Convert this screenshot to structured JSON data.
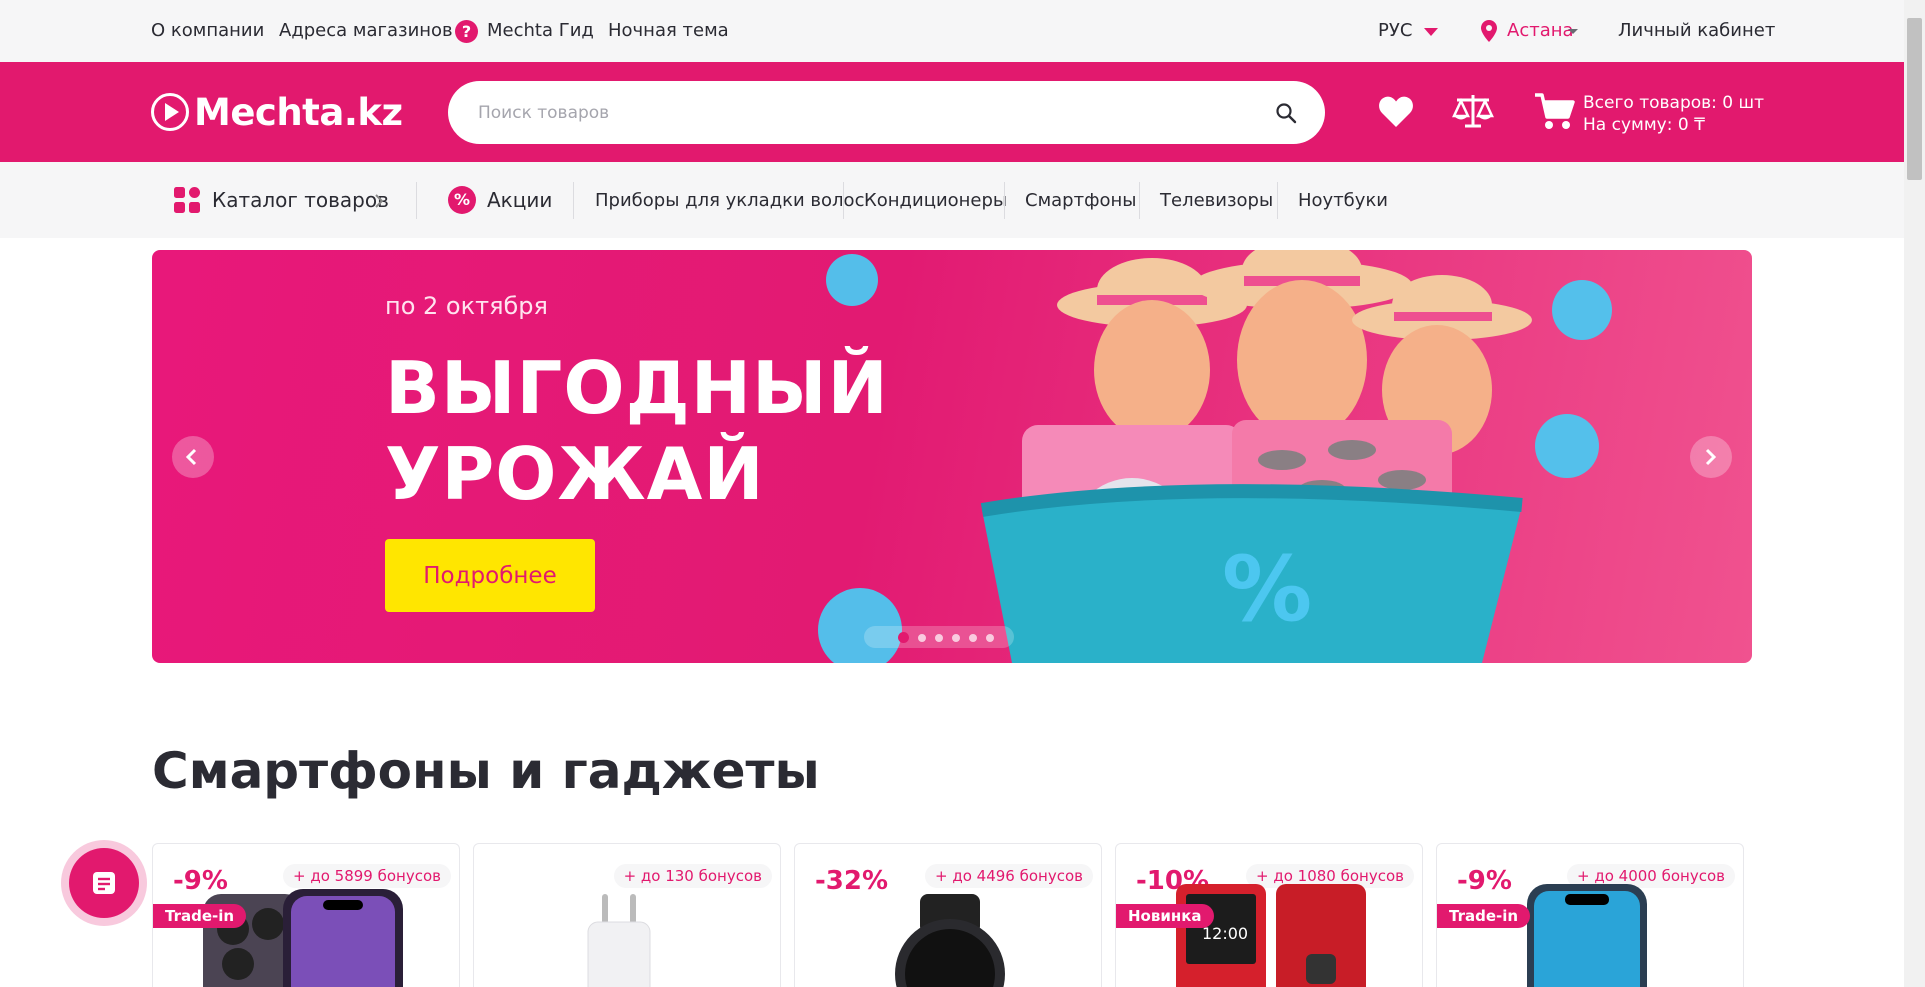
{
  "topbar": {
    "about": "О компании",
    "stores": "Адреса магазинов",
    "guide": "Mechta Гид",
    "dark_theme": "Ночная тема",
    "language": "РУС",
    "city": "Астана",
    "account": "Личный кабинет"
  },
  "header": {
    "logo": "Mechta.kz",
    "search_placeholder": "Поиск товаров",
    "cart_total_items": "Всего товаров: 0 шт",
    "cart_total_sum": "На сумму: 0 ₸"
  },
  "nav": {
    "catalog": "Каталог товаров",
    "promo": "Акции",
    "items": [
      "Приборы для укладки волос",
      "Кондиционеры",
      "Смартфоны",
      "Телевизоры",
      "Ноутбуки"
    ]
  },
  "banner": {
    "date": "по 2 октября",
    "title_line1": "ВЫГОДНЫЙ",
    "title_line2": "УРОЖАЙ",
    "button": "Подробнее",
    "slide_count": 6,
    "active_slide": 1
  },
  "section": {
    "title": "Смартфоны и гаджеты",
    "cards": [
      {
        "discount": "-9%",
        "bonus": "+ до 5899 бонусов",
        "tag": "Trade-in"
      },
      {
        "discount": "",
        "bonus": "+ до 130 бонусов",
        "tag": ""
      },
      {
        "discount": "-32%",
        "bonus": "+ до 4496 бонусов",
        "tag": ""
      },
      {
        "discount": "-10%",
        "bonus": "+ до 1080 бонусов",
        "tag": "Новинка"
      },
      {
        "discount": "-9%",
        "bonus": "+ до 4000 бонусов",
        "tag": "Trade-in"
      }
    ]
  },
  "colors": {
    "brand": "#e2196e",
    "button_yellow": "#ffe600",
    "bar_bg": "#f6f6f7"
  }
}
